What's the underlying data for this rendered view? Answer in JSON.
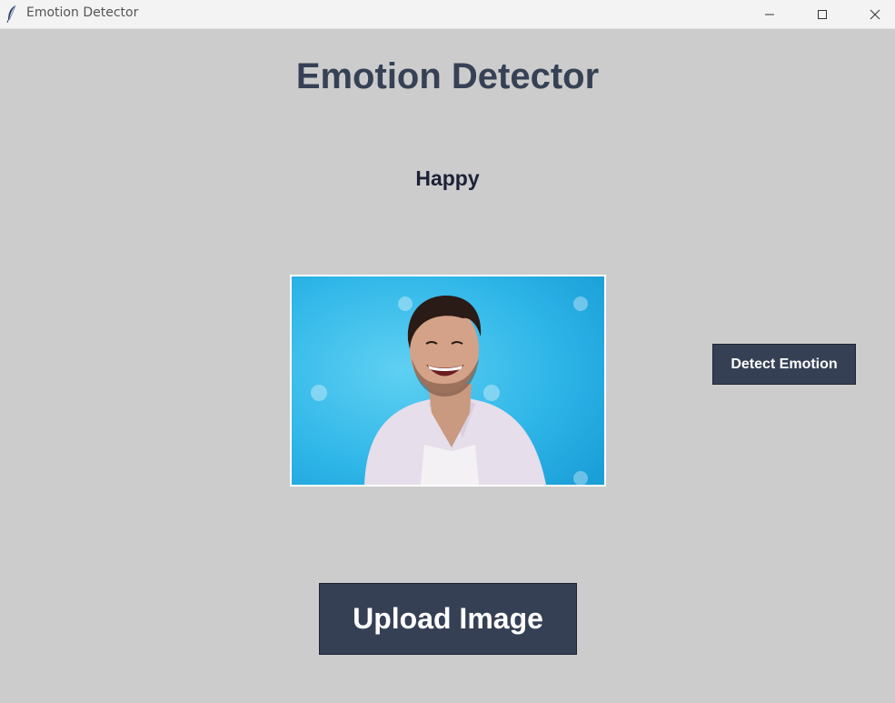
{
  "window": {
    "title": "Emotion Detector",
    "icon": "feather-icon",
    "controls": [
      "minimize-icon",
      "maximize-icon",
      "close-icon"
    ]
  },
  "app": {
    "heading": "Emotion Detector",
    "result_label": "Happy",
    "preview_image": "smiling-man-photo",
    "detect_button": "Detect Emotion",
    "upload_button": "Upload Image"
  },
  "colors": {
    "background": "#cccccc",
    "heading": "#364155",
    "button_bg": "#364055",
    "button_text": "#ffffff"
  }
}
